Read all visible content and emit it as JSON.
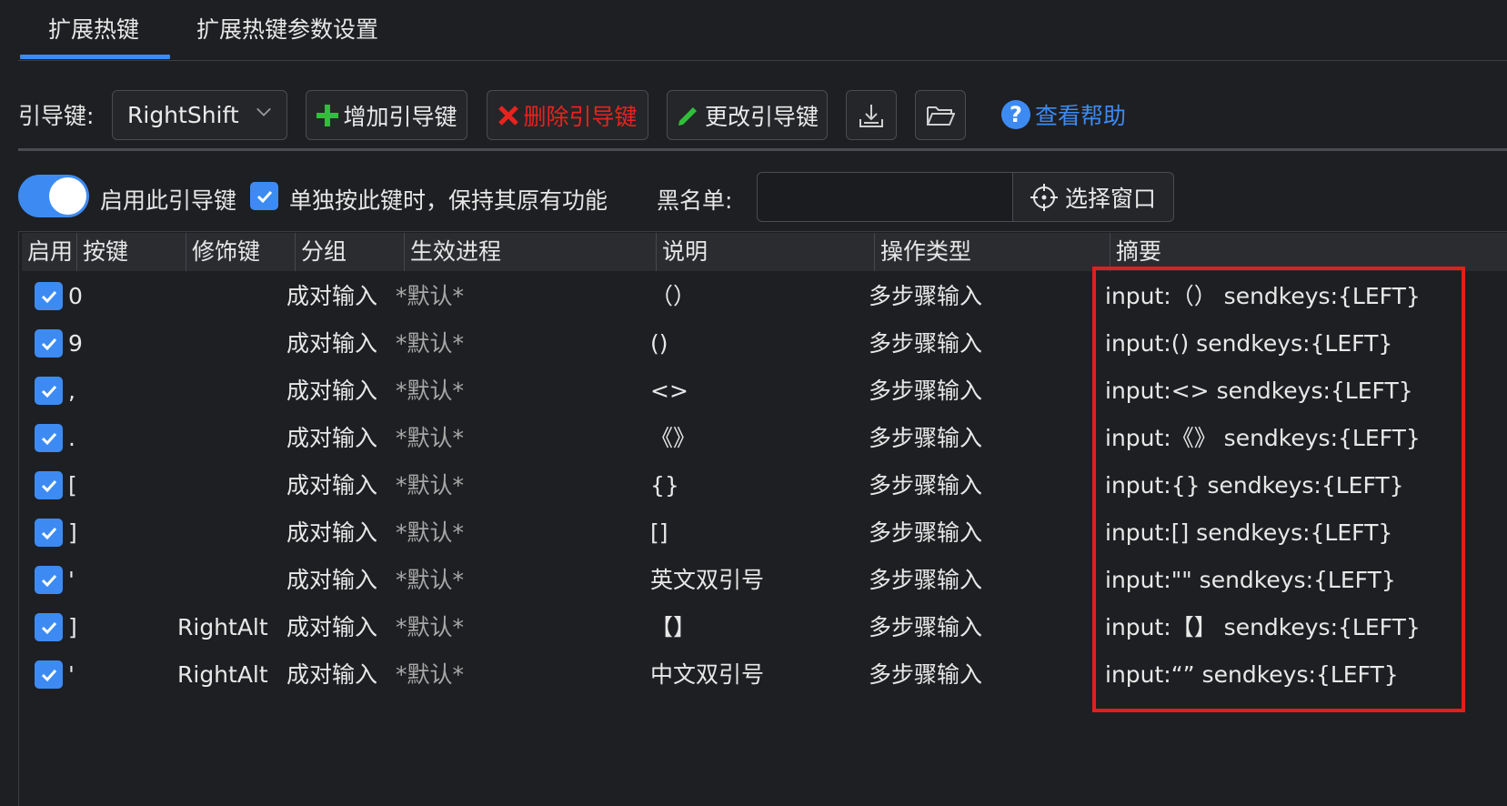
{
  "tabs": [
    "扩展热键",
    "扩展热键参数设置"
  ],
  "toolbar": {
    "leader_label": "引导键:",
    "leader_value": "RightShift",
    "add_label": "增加引导键",
    "delete_label": "删除引导键",
    "change_label": "更改引导键",
    "help_label": "查看帮助"
  },
  "options": {
    "enable_label": "启用此引导键",
    "keep_label": "单独按此键时，保持其原有功能",
    "blacklist_label": "黑名单:",
    "blacklist_value": "",
    "select_window_label": "选择窗口"
  },
  "table": {
    "headers": [
      "启用",
      "按键",
      "修饰键",
      "分组",
      "生效进程",
      "说明",
      "操作类型",
      "摘要"
    ],
    "rows": [
      {
        "key": "0",
        "modifier": "",
        "group": "成对输入",
        "process": "*默认*",
        "desc": "（）",
        "op": "多步骤输入",
        "summary": "input:（） sendkeys:{LEFT}"
      },
      {
        "key": "9",
        "modifier": "",
        "group": "成对输入",
        "process": "*默认*",
        "desc": "()",
        "op": "多步骤输入",
        "summary": "input:() sendkeys:{LEFT}"
      },
      {
        "key": ",",
        "modifier": "",
        "group": "成对输入",
        "process": "*默认*",
        "desc": "<>",
        "op": "多步骤输入",
        "summary": "input:<> sendkeys:{LEFT}"
      },
      {
        "key": ".",
        "modifier": "",
        "group": "成对输入",
        "process": "*默认*",
        "desc": "《》",
        "op": "多步骤输入",
        "summary": "input:《》 sendkeys:{LEFT}"
      },
      {
        "key": "[",
        "modifier": "",
        "group": "成对输入",
        "process": "*默认*",
        "desc": "{}",
        "op": "多步骤输入",
        "summary": "input:{} sendkeys:{LEFT}"
      },
      {
        "key": "]",
        "modifier": "",
        "group": "成对输入",
        "process": "*默认*",
        "desc": "[]",
        "op": "多步骤输入",
        "summary": "input:[] sendkeys:{LEFT}"
      },
      {
        "key": "'",
        "modifier": "",
        "group": "成对输入",
        "process": "*默认*",
        "desc": "英文双引号",
        "op": "多步骤输入",
        "summary": "input:\"\" sendkeys:{LEFT}"
      },
      {
        "key": "]",
        "modifier": "RightAlt",
        "group": "成对输入",
        "process": "*默认*",
        "desc": "【】",
        "op": "多步骤输入",
        "summary": "input:【】 sendkeys:{LEFT}"
      },
      {
        "key": "'",
        "modifier": "RightAlt",
        "group": "成对输入",
        "process": "*默认*",
        "desc": "中文双引号",
        "op": "多步骤输入",
        "summary": "input:“” sendkeys:{LEFT}"
      }
    ]
  },
  "colors": {
    "accent": "#3d8bf2",
    "delete": "#e8231d",
    "add": "#2fbf3a",
    "change": "#2fbf3a",
    "highlight_box": "#e0201a"
  }
}
